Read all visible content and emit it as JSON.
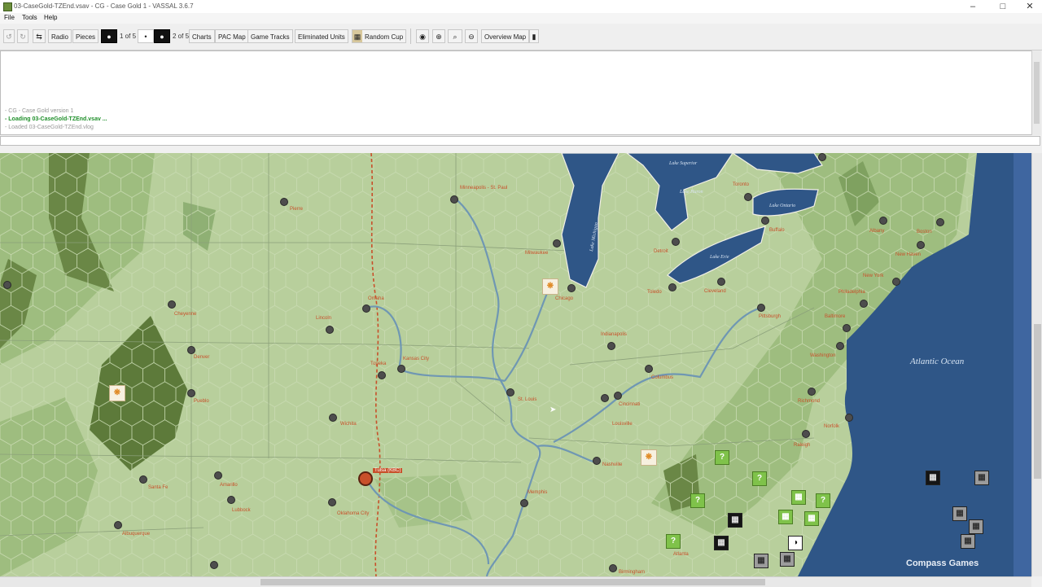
{
  "window": {
    "title": "03-CaseGold-TZEnd.vsav - CG - Case Gold 1 - VASSAL 3.6.7",
    "controls": [
      "minimize-icon",
      "maximize-icon",
      "close-icon"
    ]
  },
  "menu": {
    "file": "File",
    "tools": "Tools",
    "help": "Help"
  },
  "toolbar": {
    "radio": "Radio",
    "pieces": "Pieces",
    "page1": "1 of 5",
    "page2": "2 of 5",
    "charts": "Charts",
    "pac_map": "PAC Map",
    "game_tracks": "Game Tracks",
    "eliminated_units": "Eliminated Units",
    "random_cup": "Random Cup",
    "overview_map": "Overview Map"
  },
  "chat": {
    "lines": [
      "- CG - Case Gold version 1",
      "- Loading 03-CaseGold-TZEnd.vsav ...",
      "- Loaded 03-CaseGold-TZEnd.vlog"
    ]
  },
  "map": {
    "lakes": [
      "Lake Superior",
      "Lake Huron",
      "Lake Michigan",
      "Lake Erie",
      "Lake Ontario"
    ],
    "ocean": "Atlantic Ocean",
    "cities": [
      "Minneapolis - St. Paul",
      "Pierre",
      "Milwaukee",
      "Chicago",
      "Detroit",
      "Toronto",
      "Buffalo",
      "Albany",
      "Boston",
      "New Haven",
      "New York",
      "Philadelphia",
      "Baltimore",
      "Washington",
      "Richmond",
      "Norfolk",
      "Raleigh",
      "Cleveland",
      "Toledo",
      "Pittsburgh",
      "Columbus",
      "Indianapolis",
      "Cincinnati",
      "Louisville",
      "Nashville",
      "Memphis",
      "Birmingham",
      "St. Louis",
      "Kansas City",
      "Topeka",
      "Omaha",
      "Lincoln",
      "Cheyenne",
      "Denver",
      "Pueblo",
      "Wichita",
      "Tulsa (KBC)",
      "Oklahoma City",
      "Amarillo",
      "Lubbock",
      "Santa Fe",
      "Albuquerque",
      "Atlanta"
    ],
    "compass_label": "Compass Games"
  },
  "colors": {
    "land": "#b8cf9c",
    "hill": "#8fb074",
    "mountain": "#5d7a3a",
    "water": "#2f5687",
    "river": "#6f97b3",
    "border": "#c8502a",
    "city_label": "#c8502a"
  }
}
